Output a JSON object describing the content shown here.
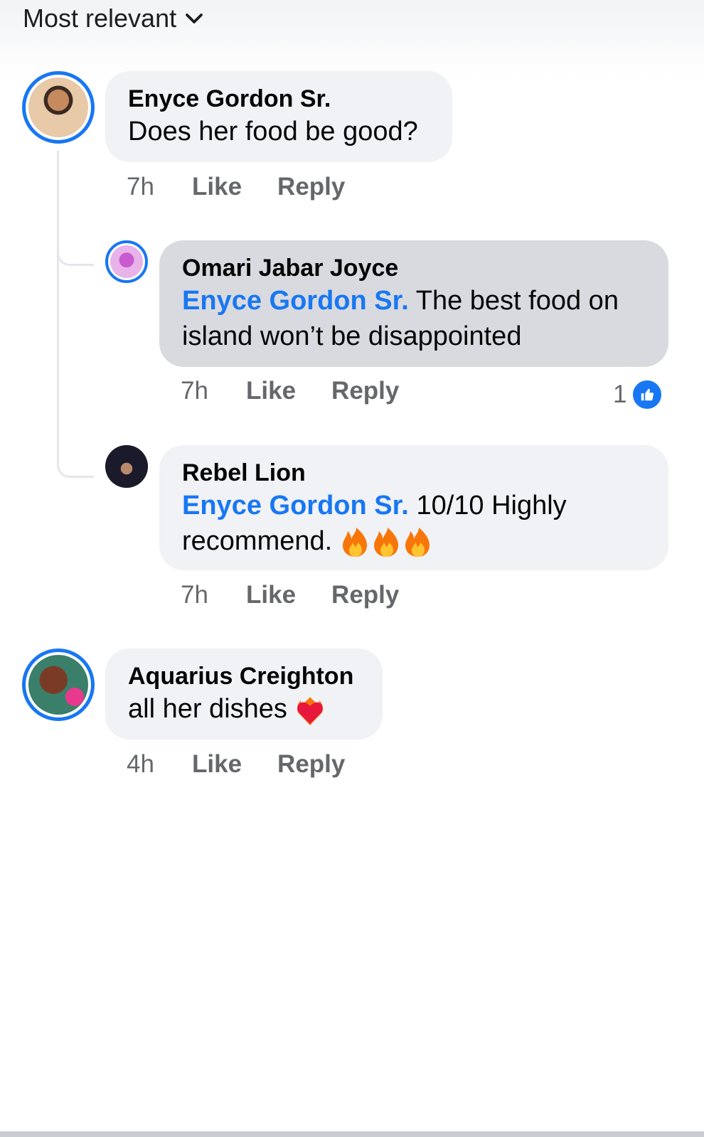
{
  "sort": {
    "label": "Most relevant"
  },
  "comments": [
    {
      "author": "Enyce Gordon Sr.",
      "text": "Does her food be good?",
      "time": "7h",
      "like_label": "Like",
      "reply_label": "Reply"
    },
    {
      "author": "Omari Jabar Joyce",
      "mention": "Enyce Gordon Sr.",
      "text": "The best food on island won’t be disappointed",
      "time": "7h",
      "like_label": "Like",
      "reply_label": "Reply",
      "reaction_count": "1"
    },
    {
      "author": "Rebel Lion",
      "mention": "Enyce Gordon Sr.",
      "text": "10/10 Highly recommend.",
      "time": "7h",
      "like_label": "Like",
      "reply_label": "Reply"
    },
    {
      "author": "Aquarius Creighton",
      "text": "all her dishes",
      "time": "4h",
      "like_label": "Like",
      "reply_label": "Reply"
    }
  ],
  "icons": {
    "sort": "chevron-down-icon",
    "reaction": "thumbs-up-icon",
    "fire": "fire-emoji",
    "heart": "heart-on-fire-emoji"
  },
  "colors": {
    "accent": "#1877f2",
    "bubble": "#f0f2f5",
    "meta": "#65676b"
  }
}
